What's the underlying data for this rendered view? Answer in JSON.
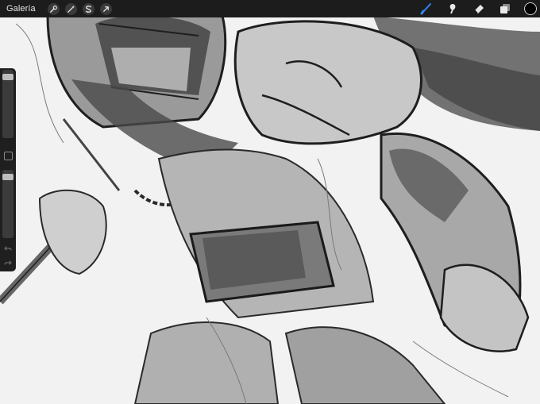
{
  "topbar": {
    "gallery_label": "Galería",
    "left_tools": [
      {
        "name": "actions",
        "icon": "wrench-icon"
      },
      {
        "name": "adjustments",
        "icon": "magic-wand-icon"
      },
      {
        "name": "selection",
        "icon": "selection-s-icon"
      },
      {
        "name": "transform",
        "icon": "arrow-cursor-icon"
      }
    ],
    "right_tools": [
      {
        "name": "brush",
        "icon": "brush-icon",
        "active": true
      },
      {
        "name": "smudge",
        "icon": "smudge-icon",
        "active": false
      },
      {
        "name": "eraser",
        "icon": "eraser-icon",
        "active": false
      },
      {
        "name": "layers",
        "icon": "layers-icon",
        "active": false
      }
    ],
    "current_color": "#000000"
  },
  "sidebar": {
    "brush_size": 0.05,
    "opacity": 0.05
  },
  "colors": {
    "toolbar_bg": "#1c1c1c",
    "active_tool": "#2f86f6",
    "canvas_bg": "#f2f2f2"
  }
}
